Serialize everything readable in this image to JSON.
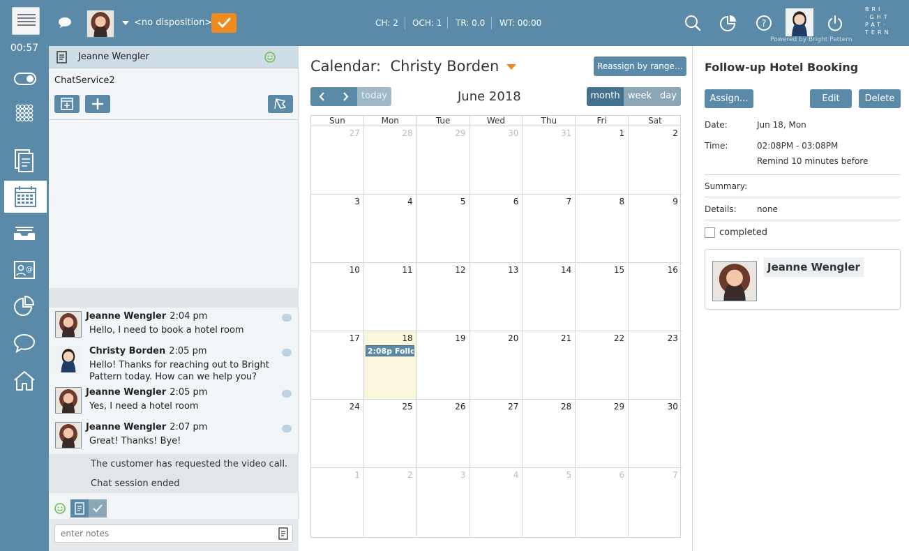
{
  "topbar": {
    "disposition": "<no disposition>",
    "timer": "00:57",
    "stats": {
      "ch": "CH: 2",
      "och": "OCH: 1",
      "tr": "TR: 0.0",
      "wt": "WT: 00:00"
    },
    "powered_by": "Powered by Bright Pattern",
    "brand_lines": [
      "BRI",
      "·GHT",
      "PAT·",
      "TERN"
    ]
  },
  "interaction": {
    "contact_name": "Jeanne Wengler",
    "service": "ChatService2",
    "messages": [
      {
        "name": "Jeanne Wengler",
        "time": "2:04 pm",
        "text": "Hello, I need to book a hotel room"
      },
      {
        "name": "Christy Borden",
        "time": "2:05 pm",
        "text": "Hello! Thanks for reaching out to Bright Pattern today. How can we help you?"
      },
      {
        "name": "Jeanne Wengler",
        "time": "2:05 pm",
        "text": "Yes, I need a hotel room"
      },
      {
        "name": "Jeanne Wengler",
        "time": "2:07 pm",
        "text": "Great! Thanks! Bye!"
      }
    ],
    "system": [
      "The customer has requested the video call.",
      "Chat session ended"
    ],
    "notes_placeholder": "enter notes"
  },
  "calendar": {
    "title_prefix": "Calendar:",
    "owner": "Christy Borden",
    "reassign_label": "Reassign by range…",
    "today_label": "today",
    "month_title": "June 2018",
    "views": [
      "month",
      "week",
      "day"
    ],
    "weekdays": [
      "Sun",
      "Mon",
      "Tue",
      "Wed",
      "Thu",
      "Fri",
      "Sat"
    ],
    "weeks": [
      [
        "27",
        "28",
        "29",
        "30",
        "31",
        "1",
        "2"
      ],
      [
        "3",
        "4",
        "5",
        "6",
        "7",
        "8",
        "9"
      ],
      [
        "10",
        "11",
        "12",
        "13",
        "14",
        "15",
        "16"
      ],
      [
        "17",
        "18",
        "19",
        "20",
        "21",
        "22",
        "23"
      ],
      [
        "24",
        "25",
        "26",
        "27",
        "28",
        "29",
        "30"
      ],
      [
        "1",
        "2",
        "3",
        "4",
        "5",
        "6",
        "7"
      ]
    ],
    "event_label": "2:08p Follo"
  },
  "details": {
    "title": "Follow-up Hotel Booking",
    "assign_label": "Assign...",
    "edit_label": "Edit",
    "delete_label": "Delete",
    "date_label": "Date:",
    "date_value": "Jun 18, Mon",
    "time_label": "Time:",
    "time_value": "02:08PM - 03:08PM",
    "remind": "Remind 10 minutes before",
    "summary_label": "Summary:",
    "details_label": "Details:",
    "details_value": "none",
    "completed_label": "completed",
    "contact_name": "Jeanne Wengler"
  }
}
